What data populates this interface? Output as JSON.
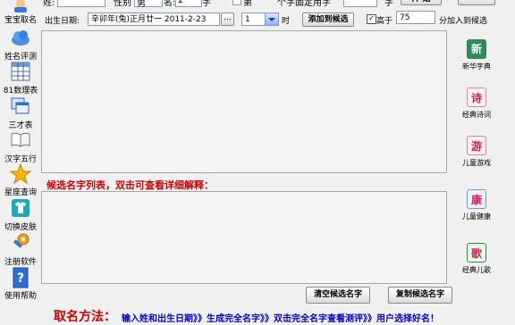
{
  "top_row": {
    "labels": [
      "姓:",
      "性别",
      "男",
      "名:",
      "2",
      "字",
      "第",
      "个字固定用字",
      "字",
      "开 始"
    ]
  },
  "sidebar": {
    "items": [
      {
        "label": "宝宝取名",
        "icon": "baby-icon"
      },
      {
        "label": "姓名评测",
        "icon": "cloud-icon"
      },
      {
        "label": "81数理表",
        "icon": "table-icon"
      },
      {
        "label": "三才表",
        "icon": "windows-icon"
      },
      {
        "label": "汉字五行",
        "icon": "book-icon"
      },
      {
        "label": "星座查询",
        "icon": "star-icon"
      },
      {
        "label": "切换皮肤",
        "icon": "tshirt-icon"
      },
      {
        "label": "注册软件",
        "icon": "key-icon"
      },
      {
        "label": "使用帮助",
        "icon": "help-icon"
      }
    ]
  },
  "birth": {
    "label": "出生日期:",
    "date_value": "辛卯年(兔)正月廿一  2011-2-23",
    "ellipsis": "...",
    "hour_value": "1",
    "hour_unit": "时",
    "add_button": "添加到候选",
    "checkbox_label": "高于",
    "checkbox_checked": true,
    "score_value": "75",
    "score_suffix": "分加入到候选"
  },
  "candidate_title": "候选名字列表，双击可查看详细解释：",
  "buttons": {
    "clear": "清空候选名字",
    "copy": "复制候选名字"
  },
  "right_panel": {
    "items": [
      {
        "label": "新华字典",
        "glyph": "新",
        "icon": "dictionary-icon"
      },
      {
        "label": "经典诗词",
        "glyph": "诗",
        "icon": "poem-icon"
      },
      {
        "label": "儿童游戏",
        "glyph": "游",
        "icon": "game-icon"
      },
      {
        "label": "儿童健康",
        "glyph": "康",
        "icon": "health-icon"
      },
      {
        "label": "经典儿歌",
        "glyph": "歌",
        "icon": "song-icon"
      }
    ]
  },
  "footer": {
    "title": "取名方法：",
    "steps": "输入姓和出生日期》》生成完全名字》》双击完全名字查看测评》》用户选择好名！"
  },
  "colors": {
    "accent_red": "#cc0000",
    "accent_blue": "#0000cc",
    "list_bg": "#f4f4f4"
  }
}
